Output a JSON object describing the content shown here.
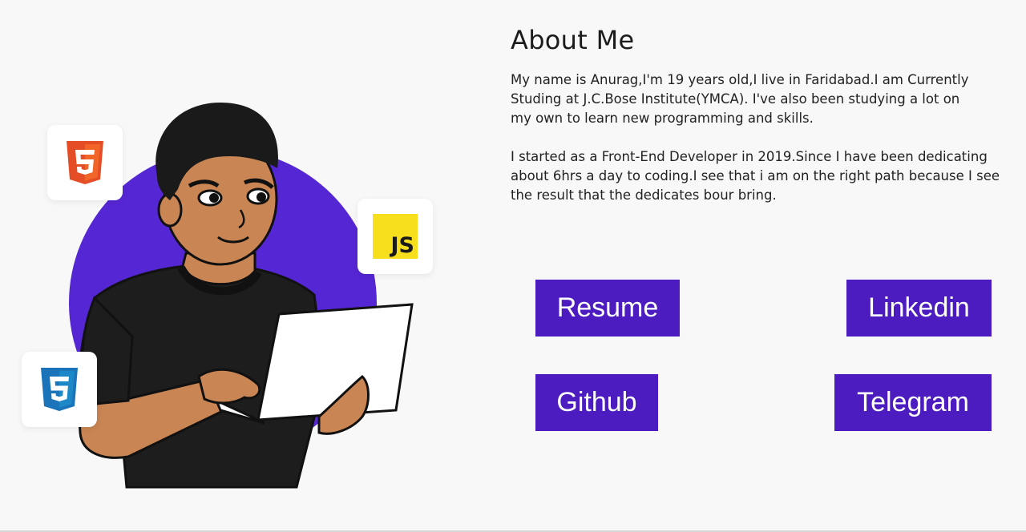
{
  "about": {
    "title": "About Me",
    "paragraph1": "My name is Anurag,I'm 19 years old,I live in Faridabad.I am Currently\nStuding at J.C.Bose Institute(YMCA). I've also been studying a lot on\nmy own to learn new programming and skills.",
    "paragraph2": "I started as a Front-End Developer in 2019.Since I have been dedicating\nabout 6hrs a day to coding.I see that i am on the right path because I see\nthe result that the dedicates bour bring."
  },
  "buttons": {
    "resume": "Resume",
    "linkedin": "Linkedin",
    "github": "Github",
    "telegram": "Telegram"
  },
  "illustration": {
    "js_badge": "JS",
    "html_badge": "5",
    "css_badge": "3",
    "icons": [
      "html5-icon",
      "javascript-icon",
      "css3-icon"
    ]
  },
  "colors": {
    "accent": "#4c1cc0",
    "circle": "#5b28d6",
    "background": "#f8f8f8",
    "html5": "#e44d26",
    "css3": "#1b73ba",
    "js": "#f7df1e"
  }
}
